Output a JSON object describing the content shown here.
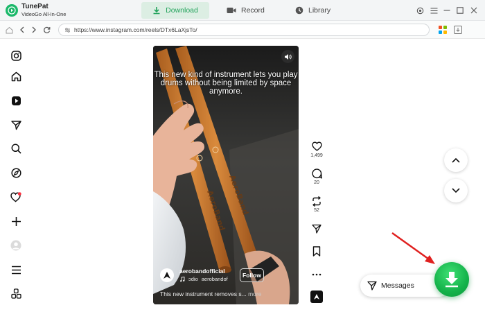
{
  "app": {
    "name": "TunePat",
    "subtitle": "VideoGo All-In-One",
    "brand_color": "#1bb86a"
  },
  "tabs": [
    {
      "label": "Download",
      "icon": "download-icon",
      "active": true
    },
    {
      "label": "Record",
      "icon": "record-icon",
      "active": false
    },
    {
      "label": "Library",
      "icon": "library-icon",
      "active": false
    }
  ],
  "window_controls": [
    "settings-icon",
    "menu-icon",
    "minimize-icon",
    "maximize-icon",
    "close-icon"
  ],
  "address_bar": {
    "url": "https://www.instagram.com/reels/DTx6LaXjsTo/"
  },
  "sidebar": {
    "items": [
      "instagram-logo-icon",
      "home-icon",
      "reels-icon",
      "send-icon",
      "search-icon",
      "explore-icon",
      "notifications-heart-icon",
      "create-plus-icon",
      "profile-icon",
      "more-menu-icon",
      "meta-apps-icon"
    ]
  },
  "video": {
    "caption": "This new kind of instrument lets you play drums without being limited by space anymore.",
    "account": "aerobandofficial",
    "audio_prefix": "ɔdio",
    "audio_track": "aerobandof",
    "follow_label": "Follow",
    "description": "This new instrument removes s...",
    "more_label": "more"
  },
  "actions": {
    "likes": "1,499",
    "comments": "20",
    "reposts": "52"
  },
  "messages": {
    "label": "Messages"
  },
  "colors": {
    "accent": "#23a35c",
    "annotation_arrow": "#e0201f",
    "download_button": "#14b24a"
  }
}
